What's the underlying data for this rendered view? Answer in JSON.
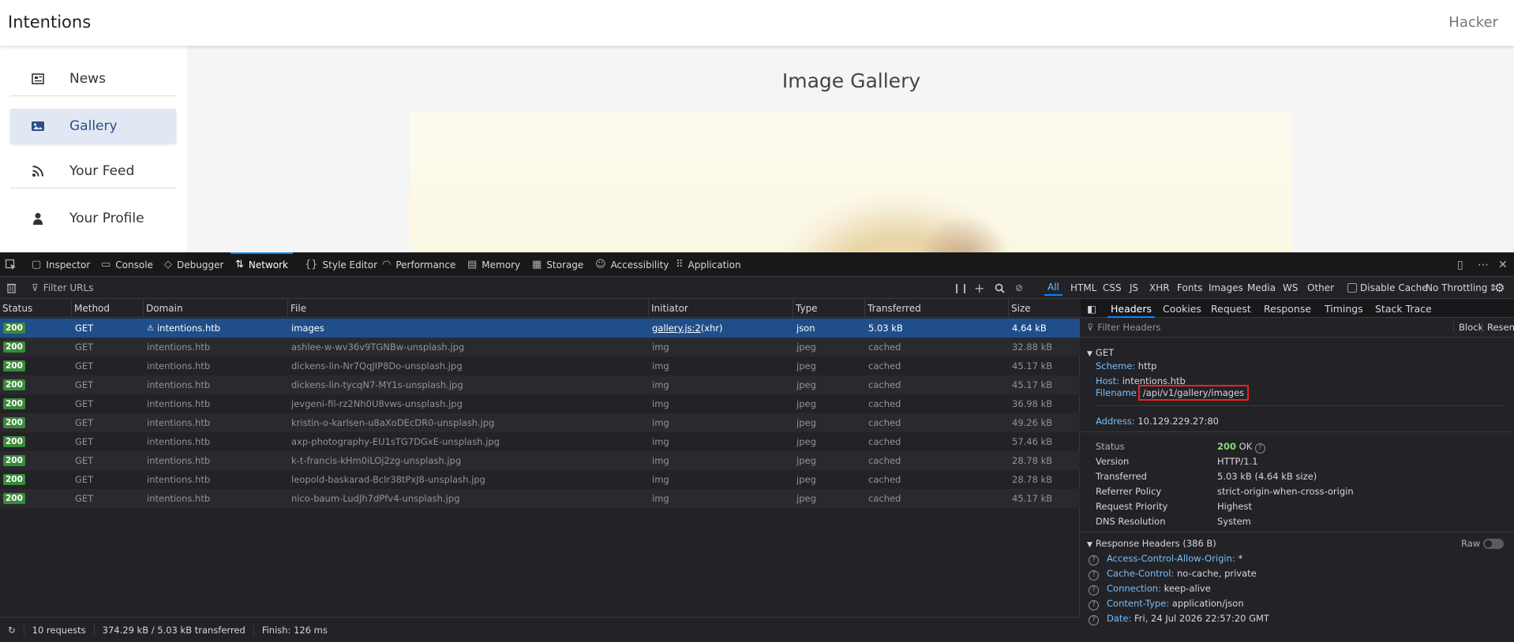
{
  "app": {
    "brand": "Intentions",
    "user": "Hacker",
    "nav": [
      {
        "label": "News",
        "icon": "newspaper-icon"
      },
      {
        "label": "Gallery",
        "icon": "image-icon",
        "active": true
      },
      {
        "label": "Your Feed",
        "icon": "rss-icon"
      },
      {
        "label": "Your Profile",
        "icon": "user-icon"
      }
    ],
    "gallery_title": "Image Gallery"
  },
  "devtools": {
    "tabs": [
      "Inspector",
      "Console",
      "Debugger",
      "Network",
      "Style Editor",
      "Performance",
      "Memory",
      "Storage",
      "Accessibility",
      "Application"
    ],
    "active_tab": "Network",
    "filter_placeholder": "Filter URLs",
    "type_filters": [
      "All",
      "HTML",
      "CSS",
      "JS",
      "XHR",
      "Fonts",
      "Images",
      "Media",
      "WS",
      "Other"
    ],
    "active_type": "All",
    "disable_cache": "Disable Cache",
    "throttling": "No Throttling",
    "columns": [
      "Status",
      "Method",
      "Domain",
      "File",
      "Initiator",
      "Type",
      "Transferred",
      "Size"
    ],
    "requests": [
      {
        "status": "200",
        "method": "GET",
        "domain": "intentions.htb",
        "file": "images",
        "initiator": "gallery.js:2",
        "initiator_suffix": " (xhr)",
        "type": "json",
        "transferred": "5.03 kB",
        "size": "4.64 kB"
      },
      {
        "status": "200",
        "method": "GET",
        "domain": "intentions.htb",
        "file": "ashlee-w-wv36v9TGNBw-unsplash.jpg",
        "initiator": "img",
        "initiator_suffix": "",
        "type": "jpeg",
        "transferred": "cached",
        "size": "32.88 kB"
      },
      {
        "status": "200",
        "method": "GET",
        "domain": "intentions.htb",
        "file": "dickens-lin-Nr7QqJIP8Do-unsplash.jpg",
        "initiator": "img",
        "initiator_suffix": "",
        "type": "jpeg",
        "transferred": "cached",
        "size": "45.17 kB"
      },
      {
        "status": "200",
        "method": "GET",
        "domain": "intentions.htb",
        "file": "dickens-lin-tycqN7-MY1s-unsplash.jpg",
        "initiator": "img",
        "initiator_suffix": "",
        "type": "jpeg",
        "transferred": "cached",
        "size": "45.17 kB"
      },
      {
        "status": "200",
        "method": "GET",
        "domain": "intentions.htb",
        "file": "jevgeni-fil-rz2Nh0U8vws-unsplash.jpg",
        "initiator": "img",
        "initiator_suffix": "",
        "type": "jpeg",
        "transferred": "cached",
        "size": "36.98 kB"
      },
      {
        "status": "200",
        "method": "GET",
        "domain": "intentions.htb",
        "file": "kristin-o-karlsen-u8aXoDEcDR0-unsplash.jpg",
        "initiator": "img",
        "initiator_suffix": "",
        "type": "jpeg",
        "transferred": "cached",
        "size": "49.26 kB"
      },
      {
        "status": "200",
        "method": "GET",
        "domain": "intentions.htb",
        "file": "axp-photography-EU1sTG7DGxE-unsplash.jpg",
        "initiator": "img",
        "initiator_suffix": "",
        "type": "jpeg",
        "transferred": "cached",
        "size": "57.46 kB"
      },
      {
        "status": "200",
        "method": "GET",
        "domain": "intentions.htb",
        "file": "k-t-francis-kHm0iLOj2zg-unsplash.jpg",
        "initiator": "img",
        "initiator_suffix": "",
        "type": "jpeg",
        "transferred": "cached",
        "size": "28.78 kB"
      },
      {
        "status": "200",
        "method": "GET",
        "domain": "intentions.htb",
        "file": "leopold-baskarad-BcIr38tPxJ8-unsplash.jpg",
        "initiator": "img",
        "initiator_suffix": "",
        "type": "jpeg",
        "transferred": "cached",
        "size": "28.78 kB"
      },
      {
        "status": "200",
        "method": "GET",
        "domain": "intentions.htb",
        "file": "nico-baum-LudJh7dPfv4-unsplash.jpg",
        "initiator": "img",
        "initiator_suffix": "",
        "type": "jpeg",
        "transferred": "cached",
        "size": "45.17 kB"
      }
    ],
    "summary": {
      "requests": "10 requests",
      "transferred": "374.29 kB / 5.03 kB transferred",
      "finish": "Finish: 126 ms"
    },
    "panel": {
      "tabs": [
        "Headers",
        "Cookies",
        "Request",
        "Response",
        "Timings",
        "Stack Trace"
      ],
      "active_tab": "Headers",
      "filter_placeholder": "Filter Headers",
      "block": "Block",
      "resend": "Resend",
      "method": "GET",
      "scheme_label": "Scheme:",
      "scheme": "http",
      "host_label": "Host:",
      "host": "intentions.htb",
      "filename_label": "Filename",
      "filename": "/api/v1/gallery/images",
      "address_label": "Address:",
      "address": "10.129.229.27:80",
      "status_label": "Status",
      "status_code": "200",
      "status_text": "OK",
      "version_label": "Version",
      "version": "HTTP/1.1",
      "transferred_label": "Transferred",
      "transferred": "5.03 kB (4.64 kB size)",
      "referrer_label": "Referrer Policy",
      "referrer": "strict-origin-when-cross-origin",
      "priority_label": "Request Priority",
      "priority": "Highest",
      "dns_label": "DNS Resolution",
      "dns": "System",
      "response_headers_title": "Response Headers (386 B)",
      "raw": "Raw",
      "response_headers": [
        {
          "name": "Access-Control-Allow-Origin:",
          "value": "*"
        },
        {
          "name": "Cache-Control:",
          "value": "no-cache, private"
        },
        {
          "name": "Connection:",
          "value": "keep-alive"
        },
        {
          "name": "Content-Type:",
          "value": "application/json"
        },
        {
          "name": "Date:",
          "value": "Fri, 24 Jul 2026 22:57:20 GMT"
        }
      ]
    }
  }
}
